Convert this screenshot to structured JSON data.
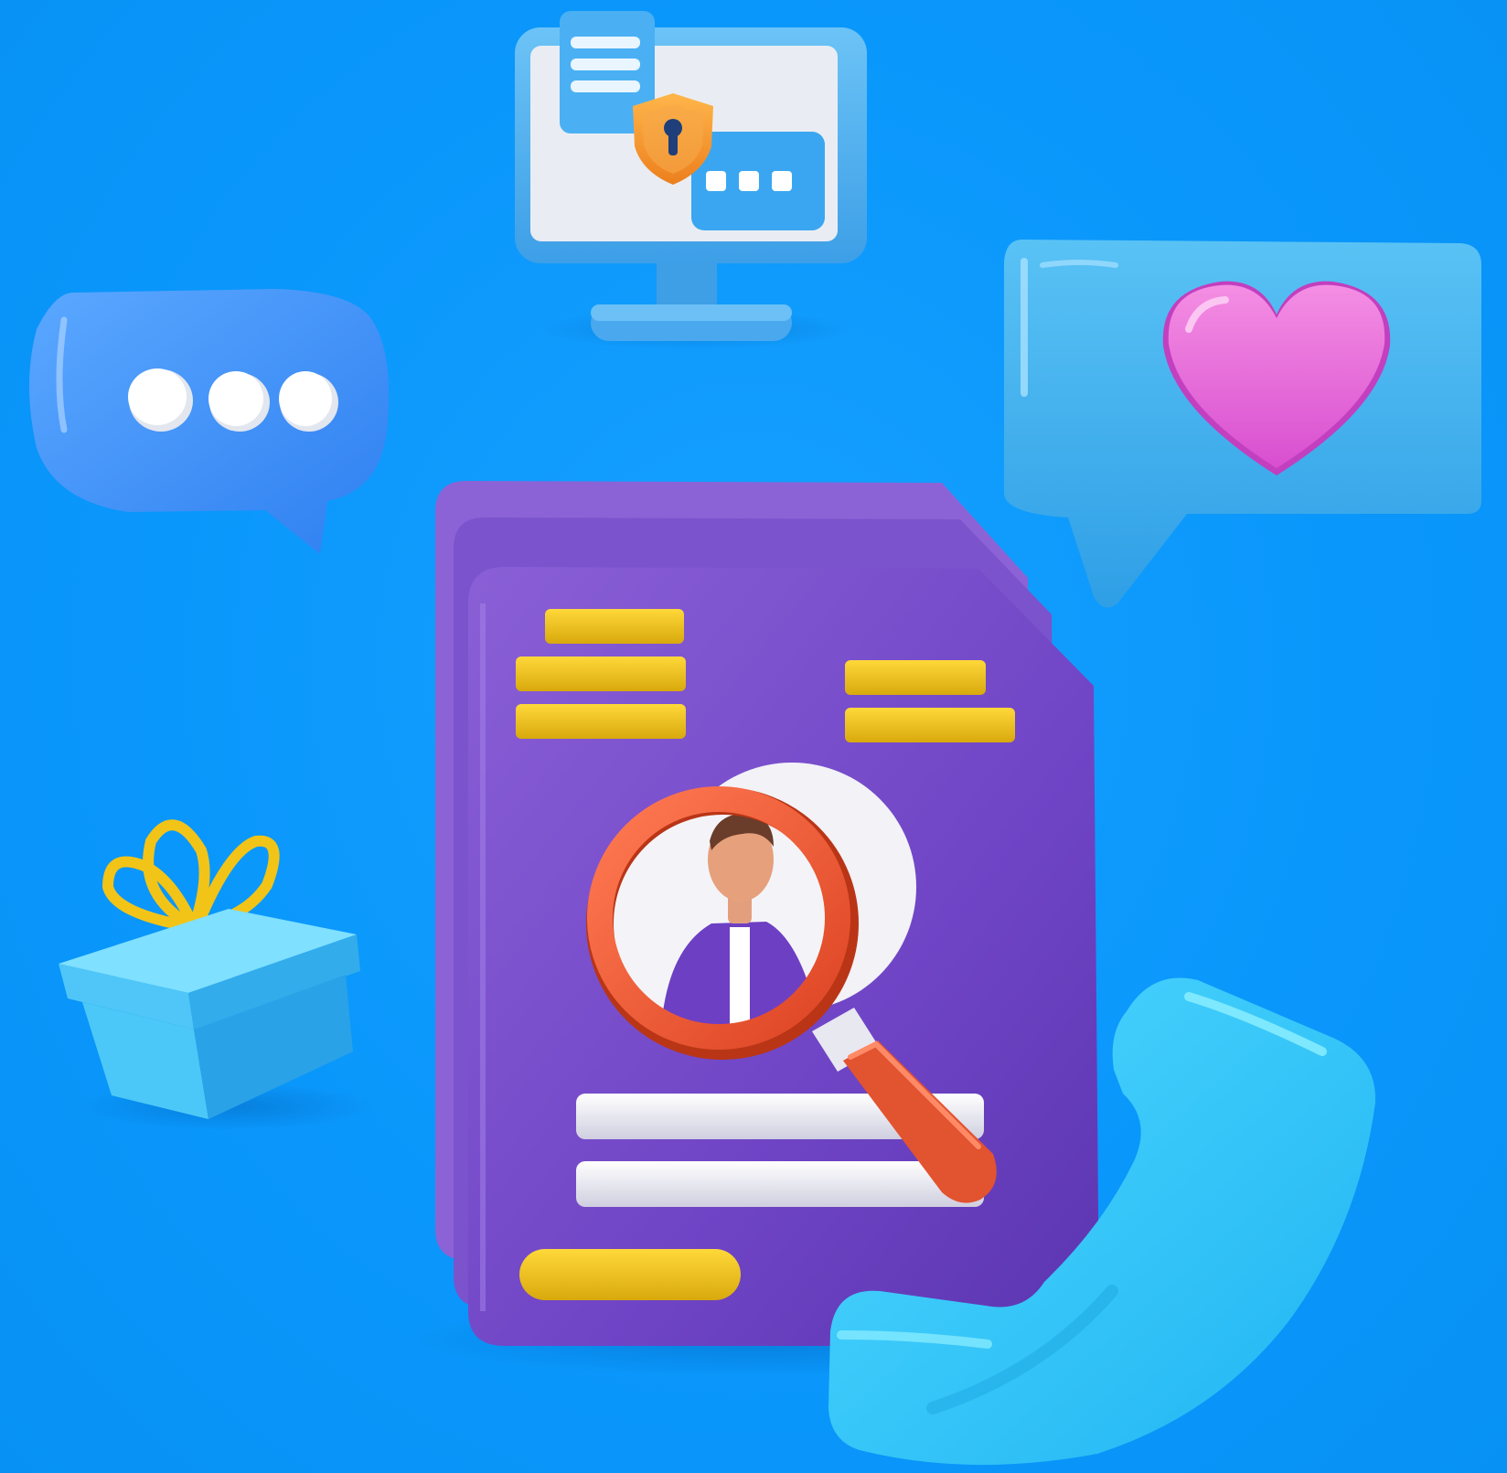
{
  "scene": {
    "background_color": "#0a97fb",
    "illustration": "3d-recruitment-resume-search",
    "objects": [
      {
        "name": "monitor-with-shield-icon",
        "icon": "monitor-icon"
      },
      {
        "name": "typing-chat-bubble-icon",
        "icon": "chat-bubble-icon"
      },
      {
        "name": "heart-speech-bubble-icon",
        "icon": "heart-icon"
      },
      {
        "name": "gift-box-icon",
        "icon": "gift-icon"
      },
      {
        "name": "resume-document-stack",
        "icon": "document-icon"
      },
      {
        "name": "magnifying-glass-icon",
        "icon": "search-icon"
      },
      {
        "name": "person-avatar-icon",
        "icon": "person-icon"
      },
      {
        "name": "phone-handset-icon",
        "icon": "phone-icon"
      }
    ],
    "colors": {
      "document_purple": "#7a4fd0",
      "document_yellow": "#f2c417",
      "magnifier_red": "#f05a35",
      "heart_pink": "#ee6fd9",
      "light_blue": "#3fb6f3",
      "phone_cyan": "#34ccff",
      "shield_orange": "#f29a30"
    }
  }
}
